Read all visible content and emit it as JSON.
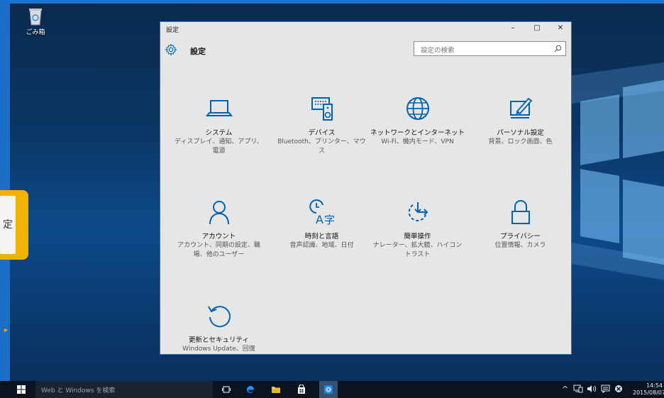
{
  "desktop": {
    "recycle_bin_label": "ごみ箱",
    "callout_text": "定",
    "callout_arrow": "▸"
  },
  "window": {
    "title": "設定",
    "controls": {
      "minimize": "–",
      "maximize": "□",
      "close": "✕"
    },
    "header_title": "設定",
    "search_placeholder": "設定の検索",
    "accent_color": "#0063b1"
  },
  "tiles": [
    {
      "name": "システム",
      "desc": "ディスプレイ、通知、アプリ、電源",
      "icon": "laptop-icon"
    },
    {
      "name": "デバイス",
      "desc": "Bluetooth、プリンター、マウス",
      "icon": "devices-icon"
    },
    {
      "name": "ネットワークとインターネット",
      "desc": "Wi-Fi、機内モード、VPN",
      "icon": "globe-icon"
    },
    {
      "name": "パーソナル設定",
      "desc": "背景、ロック画面、色",
      "icon": "personalize-icon"
    },
    {
      "name": "アカウント",
      "desc": "アカウント、同期の設定、職場、他のユーザー",
      "icon": "person-icon"
    },
    {
      "name": "時刻と言語",
      "desc": "音声認識、地域、日付",
      "icon": "time-language-icon"
    },
    {
      "name": "簡単操作",
      "desc": "ナレーター、拡大鏡、ハイコントラスト",
      "icon": "ease-of-access-icon"
    },
    {
      "name": "プライバシー",
      "desc": "位置情報、カメラ",
      "icon": "lock-icon"
    },
    {
      "name": "更新とセキュリティ",
      "desc": "Windows Update、回復",
      "icon": "update-icon"
    }
  ],
  "taskbar": {
    "search_placeholder": "Web と Windows を検索",
    "tray_chevron": "^",
    "time": "14:54",
    "date": "2015/08/07"
  }
}
